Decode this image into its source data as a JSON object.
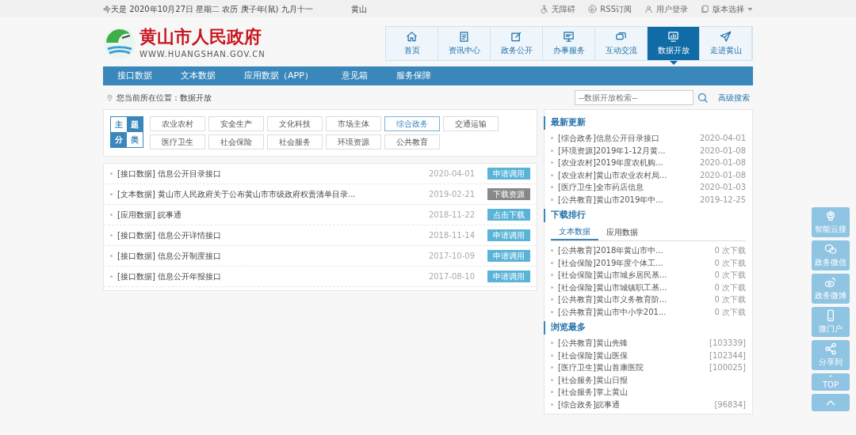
{
  "top_bar": {
    "date": "今天是 2020年10月27日 星期二 农历 庚子年(鼠) 九月十一",
    "weather": "黄山",
    "links": [
      {
        "kind": "accessibility",
        "label": "无障碍"
      },
      {
        "kind": "rss",
        "label": "RSS订阅"
      },
      {
        "kind": "user",
        "label": "用户登录"
      },
      {
        "kind": "version",
        "label": "版本选择",
        "dropdown": true
      }
    ]
  },
  "logo": {
    "title": "黄山市人民政府",
    "url": "WWW.HUANGSHAN.GOV.CN"
  },
  "main_nav": [
    {
      "kind": "home",
      "label": "首页",
      "selected": false
    },
    {
      "kind": "doc",
      "label": "资讯中心",
      "selected": false
    },
    {
      "kind": "edit",
      "label": "政务公开",
      "selected": false
    },
    {
      "kind": "monitor",
      "label": "办事服务",
      "selected": false
    },
    {
      "kind": "chat",
      "label": "互动交流",
      "selected": false
    },
    {
      "kind": "chart",
      "label": "数据开放",
      "selected": true
    },
    {
      "kind": "plane",
      "label": "走进黄山",
      "selected": false
    }
  ],
  "sub_nav": [
    "接口数据",
    "文本数据",
    "应用数据（APP）",
    "意见箱",
    "服务保障"
  ],
  "breadcrumb": {
    "label": "您当前所在位置：",
    "current": "数据开放"
  },
  "search": {
    "placeholder": "--数据开放检索--",
    "advanced": "高级搜索"
  },
  "topic_filter": {
    "heading": [
      "主",
      "题",
      "分",
      "类"
    ],
    "tags": [
      {
        "label": "农业农村",
        "selected": false
      },
      {
        "label": "安全生产",
        "selected": false
      },
      {
        "label": "文化科技",
        "selected": false
      },
      {
        "label": "市场主体",
        "selected": false
      },
      {
        "label": "综合政务",
        "selected": true
      },
      {
        "label": "交通运输",
        "selected": false
      },
      {
        "label": "医疗卫生",
        "selected": false
      },
      {
        "label": "社会保险",
        "selected": false
      },
      {
        "label": "社会服务",
        "selected": false
      },
      {
        "label": "环境资源",
        "selected": false
      },
      {
        "label": "公共教育",
        "selected": false
      }
    ]
  },
  "datasets": [
    {
      "title": "[接口数据] 信息公开目录接口",
      "date": "2020-04-01",
      "action": "申请调用",
      "kind": "api"
    },
    {
      "title": "[文本数据] 黄山市人民政府关于公布黄山市市级政府权责清单目录...",
      "date": "2019-02-21",
      "action": "下载资源",
      "kind": "file"
    },
    {
      "title": "[应用数据] 皖事通",
      "date": "2018-11-22",
      "action": "点击下载",
      "kind": "app"
    },
    {
      "title": "[接口数据] 信息公开详情接口",
      "date": "2018-11-14",
      "action": "申请调用",
      "kind": "api"
    },
    {
      "title": "[接口数据] 信息公开制度接口",
      "date": "2017-10-09",
      "action": "申请调用",
      "kind": "api"
    },
    {
      "title": "[接口数据] 信息公开年报接口",
      "date": "2017-08-10",
      "action": "申请调用",
      "kind": "api"
    }
  ],
  "latest": {
    "heading": "最新更新",
    "items": [
      {
        "title": "[综合政务]信息公开目录接口",
        "meta": "2020-04-01"
      },
      {
        "title": "[环境资源]2019年1-12月黄...",
        "meta": "2020-01-08"
      },
      {
        "title": "[农业农村]2019年度农机购...",
        "meta": "2020-01-08"
      },
      {
        "title": "[农业农村]黄山市农业农村局...",
        "meta": "2020-01-08"
      },
      {
        "title": "[医疗卫生]全市药店信息",
        "meta": "2020-01-03"
      },
      {
        "title": "[公共教育]黄山市2019年中...",
        "meta": "2019-12-25"
      }
    ]
  },
  "downloads": {
    "heading": "下载排行",
    "tabs": [
      {
        "label": "文本数据",
        "selected": true
      },
      {
        "label": "应用数据",
        "selected": false
      }
    ],
    "items": [
      {
        "title": "[公共教育]2018年黄山市中...",
        "meta": "0 次下载"
      },
      {
        "title": "[社会保险]2019年度个体工...",
        "meta": "0 次下载"
      },
      {
        "title": "[社会保险]黄山市城乡居民基...",
        "meta": "0 次下载"
      },
      {
        "title": "[社会保险]黄山市城镇职工基...",
        "meta": "0 次下载"
      },
      {
        "title": "[公共教育]黄山市义务教育阶...",
        "meta": "0 次下载"
      },
      {
        "title": "[公共教育]黄山市中小学201...",
        "meta": "0 次下载"
      }
    ]
  },
  "most_viewed": {
    "heading": "浏览最多",
    "items": [
      {
        "title": "[公共教育]黄山先锋",
        "meta": "[103339]"
      },
      {
        "title": "[社会保险]黄山医保",
        "meta": "[102344]"
      },
      {
        "title": "[医疗卫生]黄山首康医院",
        "meta": "[100025]"
      },
      {
        "title": "[社会服务]黄山日报"
      },
      {
        "title": "[社会服务]掌上黄山"
      },
      {
        "title": "[综合政务]皖事通",
        "meta": "[96834]"
      }
    ]
  },
  "float_bar": [
    {
      "kind": "robot",
      "label": "智能云搜"
    },
    {
      "kind": "wechat",
      "label": "政务微信"
    },
    {
      "kind": "weibo",
      "label": "政务微博"
    },
    {
      "kind": "phone",
      "label": "微门户"
    },
    {
      "kind": "share",
      "label": "分享到"
    },
    {
      "kind": "top",
      "label": "TOP"
    },
    {
      "kind": "up"
    }
  ]
}
